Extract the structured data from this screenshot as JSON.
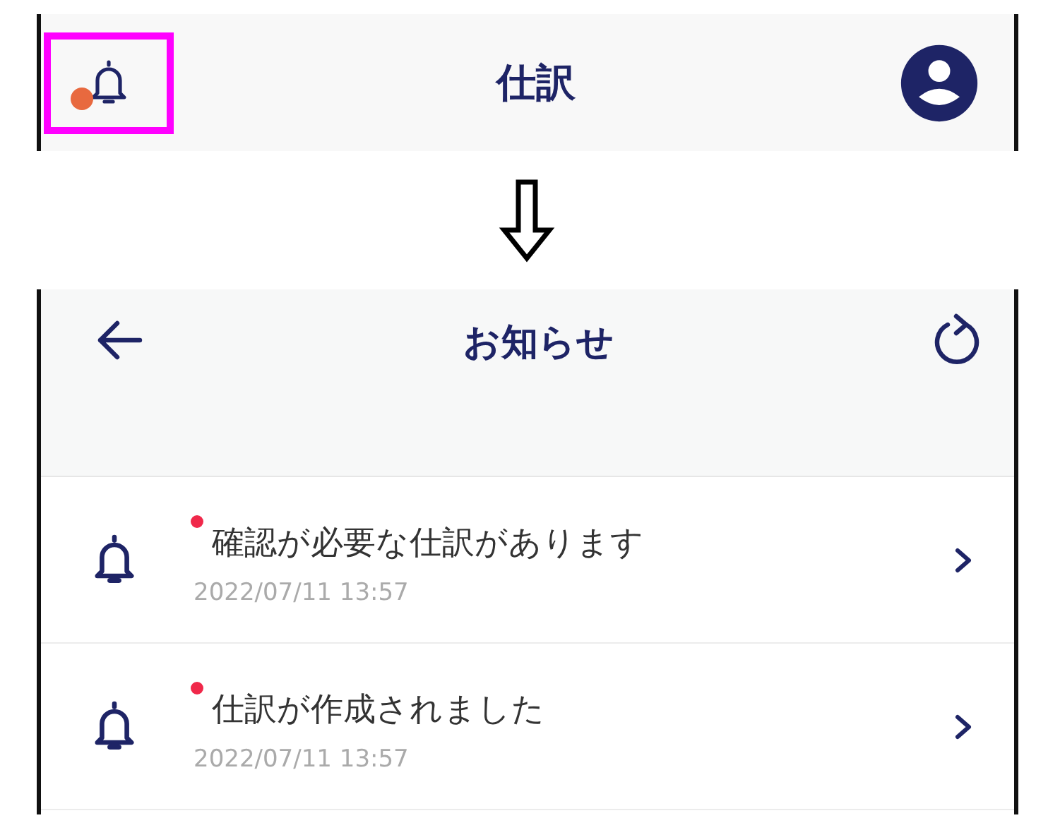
{
  "top_screen": {
    "title": "仕訳",
    "notification_badge": true,
    "bell_highlighted": true
  },
  "notice_screen": {
    "title": "お知らせ",
    "notifications": [
      {
        "title": "確認が必要な仕訳があります",
        "time": "2022/07/11 13:57",
        "unread": true
      },
      {
        "title": "仕訳が作成されました",
        "time": "2022/07/11 13:57",
        "unread": true
      }
    ]
  }
}
